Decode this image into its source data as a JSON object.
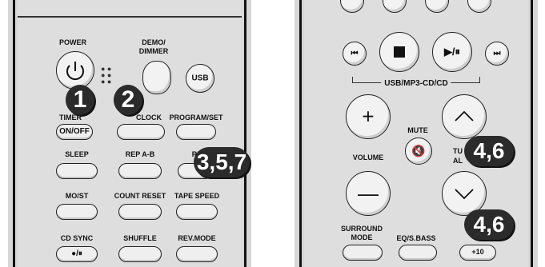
{
  "left_remote": {
    "power": "POWER",
    "demo_dimmer": "DEMO/\nDIMMER",
    "usb": "USB",
    "timer": "TIMER",
    "on_off": "ON/OFF",
    "clock": "CLOCK",
    "program_set": "PROGRAM/SET",
    "sleep": "SLEEP",
    "rep_ab": "REP A-B",
    "repeat": "REPE",
    "mo_st": "MO/ST",
    "count_reset": "COUNT RESET",
    "tape_speed": "TAPE SPEED",
    "cd_sync": "CD SYNC",
    "shuffle": "SHUFFLE",
    "rev_mode": "REV.MODE",
    "play_pause_glyph": "●/⏸"
  },
  "right_remote": {
    "group_label": "USB/MP3-CD/CD",
    "mute": "MUTE",
    "volume": "VOLUME",
    "tuning": "TU",
    "album": "AL",
    "surround_mode": "SURROUND\nMODE",
    "eq_sbass": "EQ/S.BASS",
    "plus10": "+10"
  },
  "callouts": {
    "c1": "1",
    "c2": "2",
    "c357": "3,5,7",
    "c46a": "4,6",
    "c46b": "4,6"
  },
  "colors": {
    "remote_body": "#dedede",
    "callout": "#2b2b2b",
    "button": "#efefef"
  }
}
